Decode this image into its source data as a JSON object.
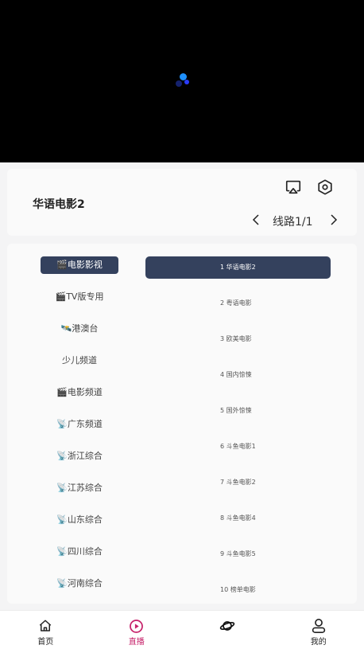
{
  "player": {
    "state": "loading"
  },
  "channel": {
    "title": "华语电影2",
    "route_label": "线路1/1",
    "icons": {
      "cast": "airplay-icon",
      "settings": "hexagon-settings-icon",
      "prev": "chevron-left-icon",
      "next": "chevron-right-icon"
    }
  },
  "categories": [
    {
      "label": "🎬电影影视"
    },
    {
      "label": "🎬TV版专用"
    },
    {
      "label": "🛰️港澳台"
    },
    {
      "label": "少儿频道"
    },
    {
      "label": "🎬电影频道"
    },
    {
      "label": "📡广东频道"
    },
    {
      "label": "📡浙江综合"
    },
    {
      "label": "📡江苏综合"
    },
    {
      "label": "📡山东综合"
    },
    {
      "label": "📡四川综合"
    },
    {
      "label": "📡河南综合"
    }
  ],
  "active_category_index": 0,
  "sources": [
    {
      "label": "1  华语电影2"
    },
    {
      "label": "2  粤语电影"
    },
    {
      "label": "3  欧美电影"
    },
    {
      "label": "4  国内惊悚"
    },
    {
      "label": "5  国外惊悚"
    },
    {
      "label": "6  斗鱼电影1"
    },
    {
      "label": "7  斗鱼电影2"
    },
    {
      "label": "8  斗鱼电影4"
    },
    {
      "label": "9  斗鱼电影5"
    },
    {
      "label": "10  榜单电影"
    }
  ],
  "active_source_index": 0,
  "tabbar": {
    "home": "首页",
    "live": "直播",
    "discover": "",
    "mine": "我的",
    "active": "live",
    "active_color": "#c6226a"
  },
  "colors": {
    "accent": "#34415d",
    "player_bg": "#000000"
  }
}
